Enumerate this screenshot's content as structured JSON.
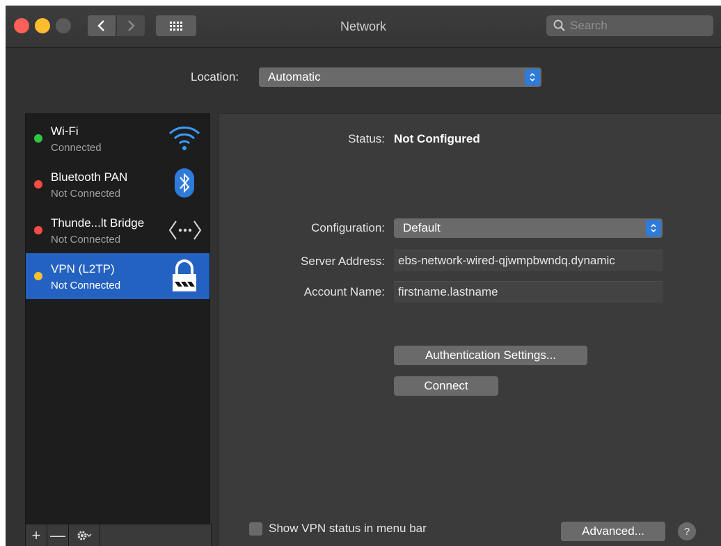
{
  "window": {
    "title": "Network"
  },
  "search": {
    "placeholder": "Search"
  },
  "location": {
    "label": "Location:",
    "value": "Automatic"
  },
  "services": [
    {
      "name": "Wi-Fi",
      "status": "Connected",
      "dot_color": "#2ec840",
      "icon": "wifi-icon",
      "selected": false
    },
    {
      "name": "Bluetooth PAN",
      "status": "Not Connected",
      "dot_color": "#fe4c44",
      "icon": "bluetooth-icon",
      "selected": false
    },
    {
      "name": "Thunde...lt Bridge",
      "status": "Not Connected",
      "dot_color": "#fe4c44",
      "icon": "thunderbolt-bridge-icon",
      "selected": false
    },
    {
      "name": "VPN (L2TP)",
      "status": "Not Connected",
      "dot_color": "#f7c131",
      "icon": "vpn-lock-icon",
      "selected": true
    }
  ],
  "sidebar_toolbar": {
    "add": "+",
    "remove": "—"
  },
  "detail": {
    "status_label": "Status:",
    "status_value": "Not Configured",
    "configuration_label": "Configuration:",
    "configuration_value": "Default",
    "server_label": "Server Address:",
    "server_value": "ebs-network-wired-qjwmpbwndq.dynamic",
    "account_label": "Account Name:",
    "account_value": "firstname.lastname",
    "auth_button": "Authentication Settings...",
    "connect_button": "Connect",
    "show_vpn_label": "Show VPN status in menu bar",
    "advanced_button": "Advanced...",
    "help": "?"
  },
  "colors": {
    "accent": "#2f7bd9",
    "selection": "#2462c2"
  }
}
